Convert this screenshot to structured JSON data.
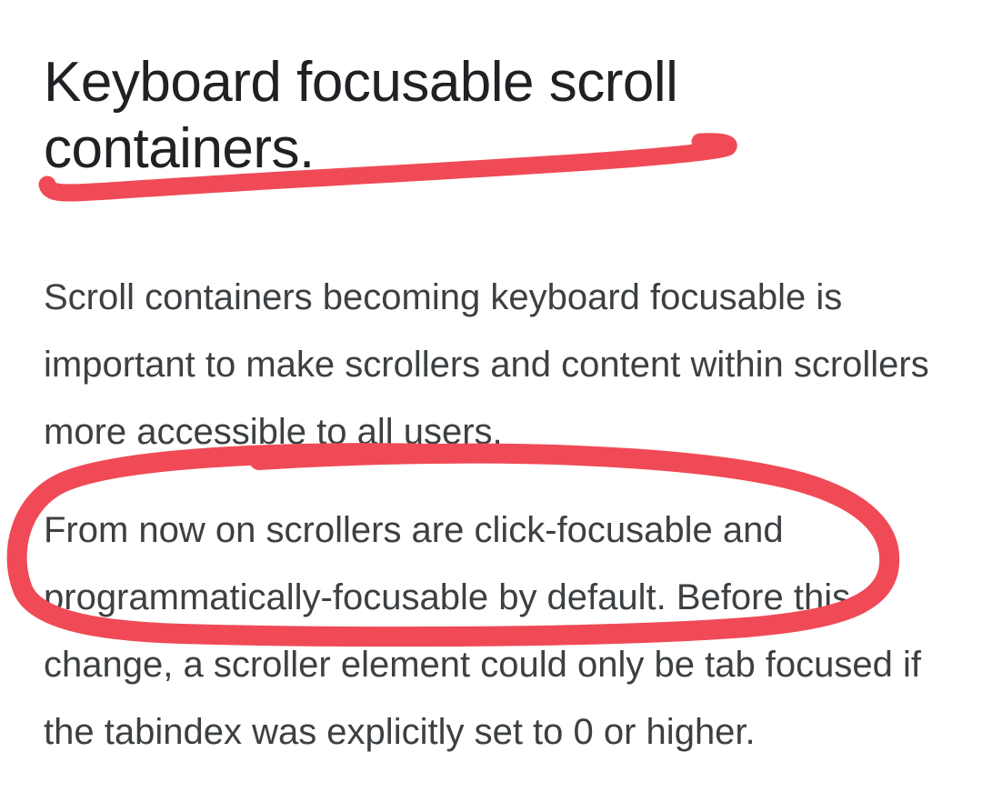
{
  "heading": "Keyboard focusable scroll containers.",
  "paragraphs": [
    "Scroll containers becoming keyboard focusable is important to make scrollers and content within scrollers more accessible to all users.",
    "From now on scrollers are click-focusable and programmatically-focusable by default. Before this change, a scroller element could only be tab focused if the tabindex was explicitly set to 0 or higher."
  ],
  "annotation": {
    "color": "#F04A56",
    "items": [
      {
        "type": "underline",
        "target": "heading"
      },
      {
        "type": "circle",
        "target": "paragraph_2_first_sentence"
      }
    ]
  }
}
